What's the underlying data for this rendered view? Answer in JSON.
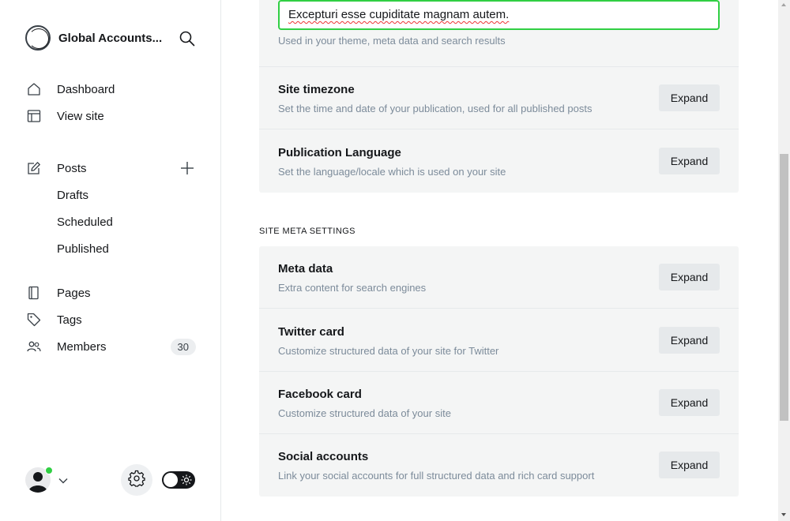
{
  "brand": {
    "name": "Global Accounts..."
  },
  "nav": {
    "dashboard": "Dashboard",
    "view_site": "View site",
    "posts": "Posts",
    "drafts": "Drafts",
    "scheduled": "Scheduled",
    "published": "Published",
    "pages": "Pages",
    "tags": "Tags",
    "members": "Members",
    "members_count": "30"
  },
  "icons": {
    "search": "search-icon",
    "dashboard": "house-icon",
    "view_site": "layout-icon",
    "posts": "pencil-square-icon",
    "add": "plus-icon",
    "pages": "page-icon",
    "tags": "tag-icon",
    "members": "users-icon",
    "settings": "gear-icon",
    "theme": "sun-icon",
    "chevron": "chevron-down-icon"
  },
  "colors": {
    "accent": "#30cf43",
    "card_bg": "#f4f5f5",
    "button_bg": "#e6e9eb",
    "muted": "#7c8b9a"
  },
  "general": {
    "title_value": "Excepturi esse cupiditate magnam autem.",
    "title_hint": "Used in your theme, meta data and search results",
    "rows": [
      {
        "title": "Site timezone",
        "desc": "Set the time and date of your publication, used for all published posts",
        "button": "Expand"
      },
      {
        "title": "Publication Language",
        "desc": "Set the language/locale which is used on your site",
        "button": "Expand"
      }
    ]
  },
  "meta_section": {
    "label": "SITE META SETTINGS",
    "rows": [
      {
        "title": "Meta data",
        "desc": "Extra content for search engines",
        "button": "Expand"
      },
      {
        "title": "Twitter card",
        "desc": "Customize structured data of your site for Twitter",
        "button": "Expand"
      },
      {
        "title": "Facebook card",
        "desc": "Customize structured data of your site",
        "button": "Expand"
      },
      {
        "title": "Social accounts",
        "desc": "Link your social accounts for full structured data and rich card support",
        "button": "Expand"
      }
    ]
  }
}
